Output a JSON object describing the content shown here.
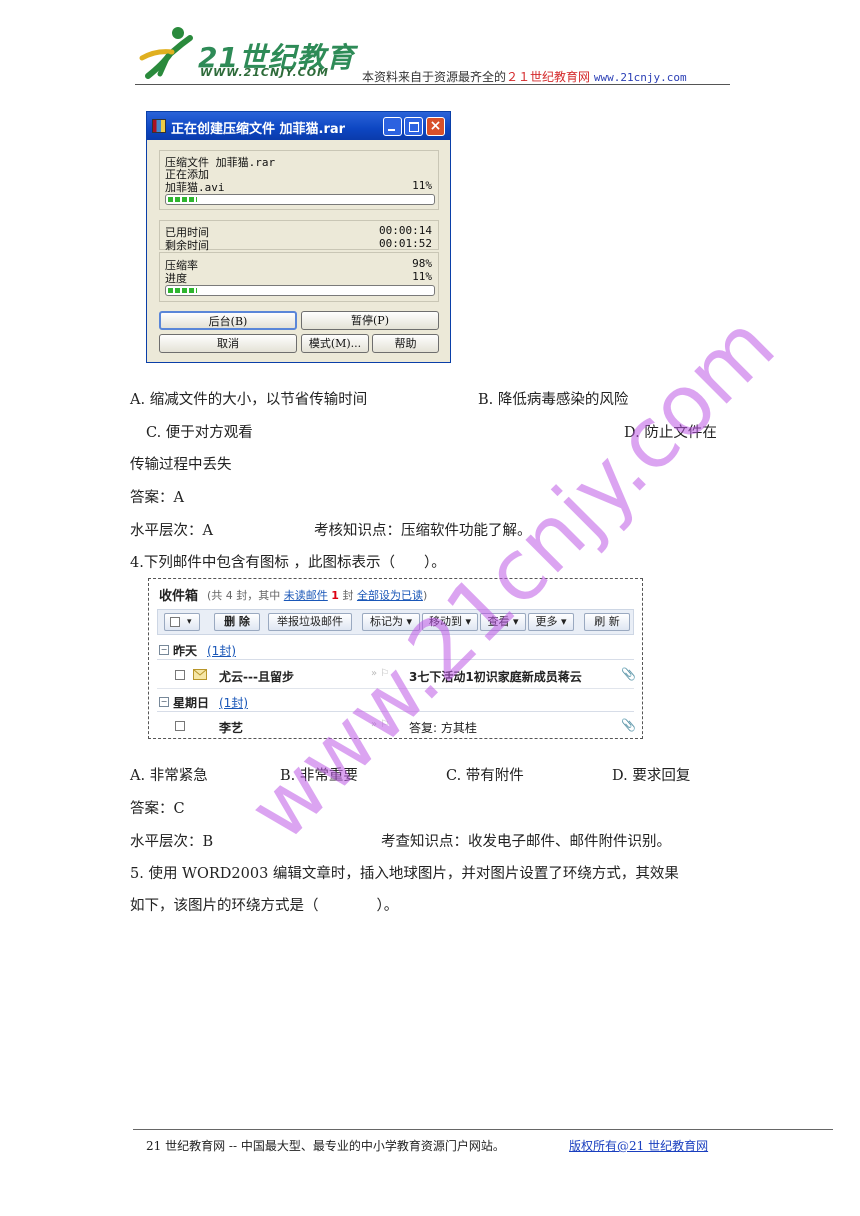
{
  "header": {
    "logo_text": "21世纪教育",
    "logo_url": "WWW.21CNJY.COM",
    "note_prefix": "本资料来自于资源最齐全的",
    "note_red": "２１世纪教育网",
    "note_url": "www.21cnjy.com"
  },
  "winrar_dialog": {
    "title": "正在创建压缩文件 加菲猫.rar",
    "archive_line": "压缩文件 加菲猫.rar",
    "adding_label": "正在添加",
    "current_file": "加菲猫.avi",
    "file_percent": "11%",
    "file_progress": 0.11,
    "elapsed_label": "已用时间",
    "elapsed_value": "00:00:14",
    "remaining_label": "剩余时间",
    "remaining_value": "00:01:52",
    "ratio_label": "压缩率",
    "ratio_value": "98%",
    "progress_label": "进度",
    "progress_value": "11%",
    "total_progress": 0.11,
    "buttons": {
      "background": "后台(B)",
      "pause": "暂停(P)",
      "cancel": "取消",
      "mode": "模式(M)...",
      "help": "帮助"
    }
  },
  "question3": {
    "option_a": "A. 缩减文件的大小，以节省传输时间",
    "option_b": "B. 降低病毒感染的风险",
    "option_c": "C. 便于对方观看",
    "option_d_part1": "D. 防止文件在",
    "option_d_part2": "传输过程中丢失",
    "answer": "答案：A",
    "level": "水平层次：A",
    "knowledge": "考核知识点：压缩软件功能了解。"
  },
  "question4": {
    "stem": "4.下列邮件中包含有图标 ，此图标表示（　　）。",
    "option_a": "A. 非常紧急",
    "option_b": "B. 非常重要",
    "option_c": "C. 带有附件",
    "option_d": "D. 要求回复",
    "answer": "答案：C",
    "level": "水平层次：B",
    "knowledge": "考查知识点：收发电子邮件、邮件附件识别。"
  },
  "mail": {
    "title": "收件箱",
    "summary_pre": "(共 4 封，其中",
    "unread_link": "未读邮件",
    "unread_count": "1",
    "summary_mid": "封",
    "mark_all_link": "全部设为已读",
    "summary_post": ")",
    "toolbar": {
      "delete": "删 除",
      "report_spam": "举报垃圾邮件",
      "mark_as": "标记为 ▾",
      "move_to": "移动到 ▾",
      "view": "查看 ▾",
      "more": "更多 ▾",
      "refresh": "刷 新"
    },
    "group1_label": "昨天",
    "group1_count": "(1封)",
    "row1_sender": "尤云---且留步",
    "row1_subject": "3七下活动1初识家庭新成员蒋云",
    "group2_label": "星期日",
    "group2_count": "(1封)",
    "row2_sender": "李艺",
    "row2_subject": "答复: 方其桂"
  },
  "question5": {
    "line1": "5. 使用 WORD2003 编辑文章时，插入地球图片，并对图片设置了环绕方式，其效果",
    "line2": "如下，该图片的环绕方式是（　　　　）。"
  },
  "footer": {
    "text": "21 世纪教育网 -- 中国最大型、最专业的中小学教育资源门户网站。",
    "link": "版权所有@21 世纪教育网"
  },
  "watermark": "www.21cnjy.com"
}
